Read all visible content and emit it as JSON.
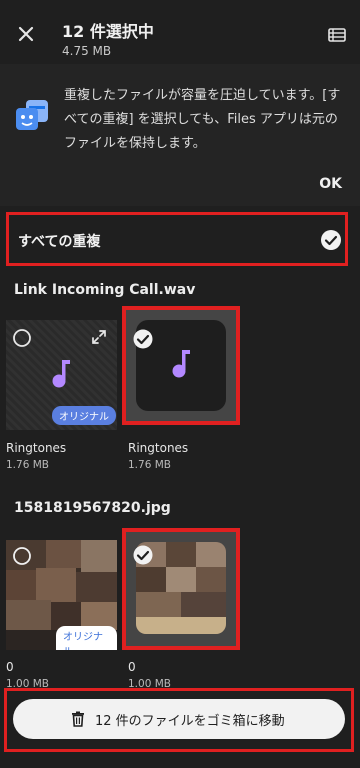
{
  "header": {
    "title": "12 件選択中",
    "subtitle": "4.75 MB",
    "close_icon": "close-icon",
    "list_icon": "list-view-icon"
  },
  "info": {
    "text": "重複したファイルが容量を圧迫しています。[すべての重複] を選択しても、Files アプリは元のファイルを保持します。",
    "ok_label": "OK"
  },
  "all_duplicates": {
    "label": "すべての重複",
    "checked": true
  },
  "groups": [
    {
      "title": "Link Incoming Call.wav",
      "items": [
        {
          "name": "Ringtones",
          "size": "1.76 MB",
          "badge": "オリジナル",
          "selected": false
        },
        {
          "name": "Ringtones",
          "size": "1.76 MB",
          "selected": true
        }
      ]
    },
    {
      "title": "1581819567820.jpg",
      "items": [
        {
          "name": "0",
          "size": "1.00 MB",
          "badge": "オリジナル",
          "selected": false
        },
        {
          "name": "0",
          "size": "1.00 MB",
          "selected": true
        }
      ]
    }
  ],
  "bottom": {
    "trash_label": "12 件のファイルをゴミ箱に移動"
  },
  "colors": {
    "accent_highlight": "#e02020",
    "music_note": "#b388ff",
    "badge": "#5a7fe0",
    "background": "#1f1f1f"
  }
}
